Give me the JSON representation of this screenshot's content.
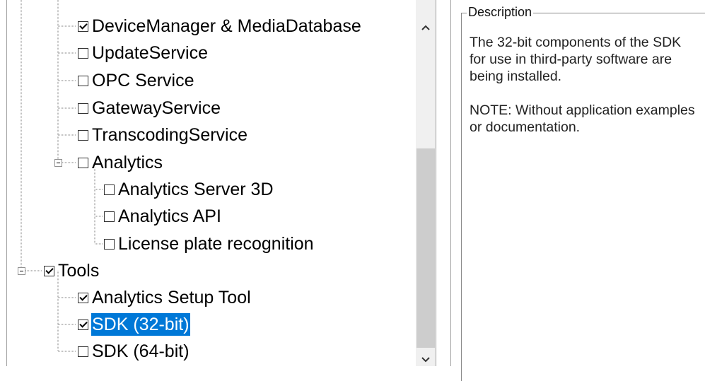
{
  "tree": {
    "items": [
      {
        "label": "DeviceManager & MediaDatabase",
        "checked": true,
        "selected": false
      },
      {
        "label": "UpdateService",
        "checked": false,
        "selected": false
      },
      {
        "label": "OPC Service",
        "checked": false,
        "selected": false
      },
      {
        "label": "GatewayService",
        "checked": false,
        "selected": false
      },
      {
        "label": "TranscodingService",
        "checked": false,
        "selected": false
      },
      {
        "label": "Analytics",
        "checked": false,
        "selected": false
      },
      {
        "label": "Analytics Server 3D",
        "checked": false,
        "selected": false
      },
      {
        "label": "Analytics API",
        "checked": false,
        "selected": false
      },
      {
        "label": "License plate recognition",
        "checked": false,
        "selected": false
      },
      {
        "label": "Tools",
        "checked": true,
        "selected": false
      },
      {
        "label": "Analytics Setup Tool",
        "checked": true,
        "selected": false
      },
      {
        "label": "SDK (32-bit)",
        "checked": true,
        "selected": true
      },
      {
        "label": "SDK (64-bit)",
        "checked": false,
        "selected": false
      }
    ]
  },
  "description": {
    "legend": "Description",
    "paragraph_1": "The 32-bit components of the SDK for use in third-party software are being installed.",
    "paragraph_2": "NOTE: Without application examples or documentation."
  },
  "colors": {
    "selection": "#0078d7",
    "scroll_thumb": "#cdcdcd"
  }
}
